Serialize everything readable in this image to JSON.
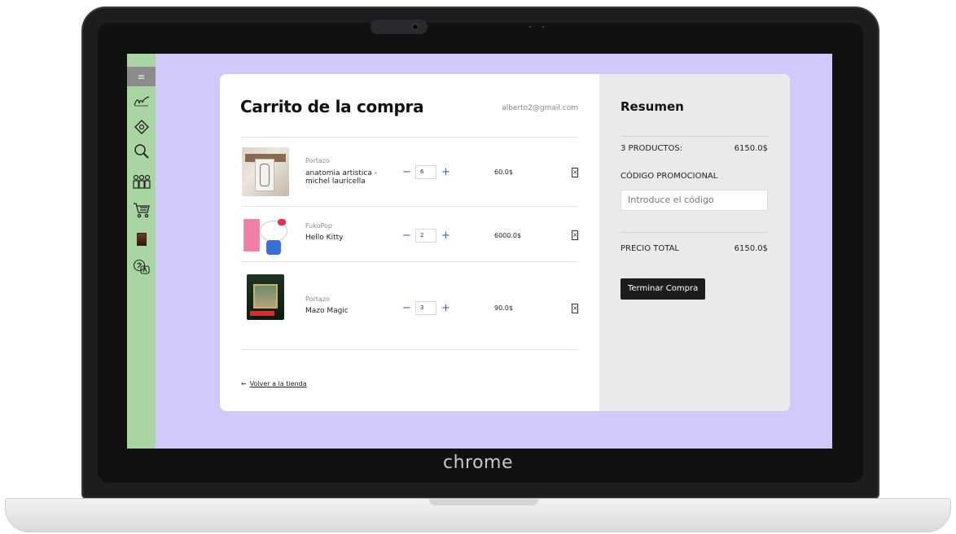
{
  "device": {
    "brand_label": "chrome"
  },
  "sidebar": {
    "items": [
      {
        "icon": "menu-icon"
      },
      {
        "icon": "signature-icon"
      },
      {
        "icon": "tag-icon"
      },
      {
        "icon": "search-icon"
      },
      {
        "icon": "figures-icon"
      },
      {
        "icon": "cart-icon"
      },
      {
        "icon": "book-icon"
      },
      {
        "icon": "translate-icon"
      }
    ]
  },
  "cart": {
    "title": "Carrito de la compra",
    "user_email": "alberto2@gmail.com",
    "items": [
      {
        "brand": "Portazo",
        "name": "anatomia artistica - michel lauricella",
        "quantity": "6",
        "price": "60.0$"
      },
      {
        "brand": "FukoPop",
        "name": "Hello Kitty",
        "quantity": "2",
        "price": "6000.0$"
      },
      {
        "brand": "Portazo",
        "name": "Mazo Magic",
        "quantity": "3",
        "price": "90.0$"
      }
    ],
    "qty_minus": "−",
    "qty_plus": "+",
    "remove_glyph": "×",
    "back_arrow": "←",
    "back_label": "Volver a la tienda"
  },
  "summary": {
    "title": "Resumen",
    "products_label": "3 PRODUCTOS:",
    "products_value": "6150.0$",
    "promo_label": "CÓDIGO PROMOCIONAL",
    "promo_placeholder": "Introduce el código",
    "total_label": "PRECIO TOTAL",
    "total_value": "6150.0$",
    "finish_button": "Terminar Compra"
  },
  "colors": {
    "screen_bg": "#d0c9fb",
    "sidebar_bg": "#a8d5a2",
    "qty_accent": "#3a5ccc",
    "summary_bg": "#eaeaea",
    "button_bg": "#1c1c1c"
  }
}
